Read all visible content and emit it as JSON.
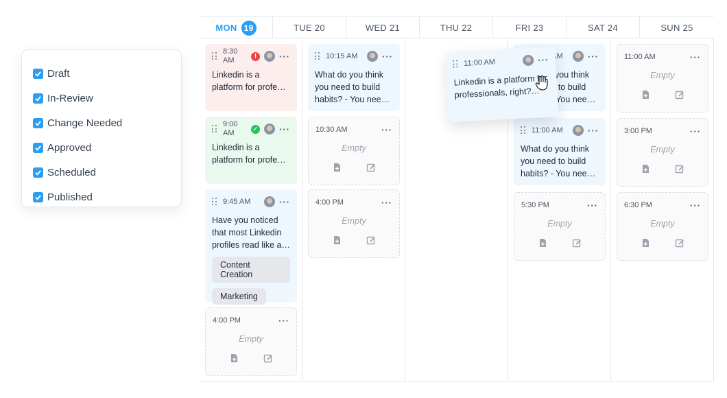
{
  "filters": [
    {
      "label": "Draft",
      "checked": true
    },
    {
      "label": "In-Review",
      "checked": true
    },
    {
      "label": "Change Needed",
      "checked": true
    },
    {
      "label": "Approved",
      "checked": true
    },
    {
      "label": "Scheduled",
      "checked": true
    },
    {
      "label": "Published",
      "checked": true
    }
  ],
  "days": {
    "mon": {
      "label": "MON",
      "num": "19"
    },
    "tue": "TUE 20",
    "wed": "WED 21",
    "thu": "THU 22",
    "fri": "FRI 23",
    "sat": "SAT 24",
    "sun": "SUN 25"
  },
  "mon": {
    "c1": {
      "time": "8:30\nAM",
      "text": "Linkedin is a platform for profe…"
    },
    "c2": {
      "time": "9:00\nAM",
      "text": "Linkedin is a platform for profe…"
    },
    "c3": {
      "time": "9:45 AM",
      "text": "Have you noticed that most Linkedin profiles read like a…",
      "tags": [
        "Content Creation",
        "Marketing"
      ]
    },
    "c4": {
      "time": "4:00 PM",
      "empty": "Empty"
    }
  },
  "tue": {
    "c1": {
      "time": "10:15 AM",
      "text": "What do you think you need to build habits? - You nee…"
    },
    "c2": {
      "time": "10:30 AM",
      "empty": "Empty"
    },
    "c3": {
      "time": "4:00 PM",
      "empty": "Empty"
    }
  },
  "fri": {
    "c1": {
      "time": "11:15 AM",
      "text": "What do you think you need to build habits? - You nee…"
    },
    "c2": {
      "time": "11:00 AM",
      "text": "What do you think you need to build habits? - You nee…"
    },
    "c3": {
      "time": "5:30 PM",
      "empty": "Empty"
    }
  },
  "sun": {
    "c1": {
      "time": "11:00 AM",
      "empty": "Empty"
    },
    "c2": {
      "time": "3:00 PM",
      "empty": "Empty"
    },
    "c3": {
      "time": "6:30 PM",
      "empty": "Empty"
    }
  },
  "drag": {
    "time": "11:00 AM",
    "text": "Linkedin is a platform for professionals, right?…"
  },
  "colors": {
    "accent": "#2a9df4",
    "red": "#ef4444",
    "green": "#22c55e"
  },
  "icons": [
    "drag-handle-icon",
    "more-icon",
    "error-icon",
    "check-icon",
    "add-file-icon",
    "edit-icon",
    "hand-cursor-icon"
  ]
}
